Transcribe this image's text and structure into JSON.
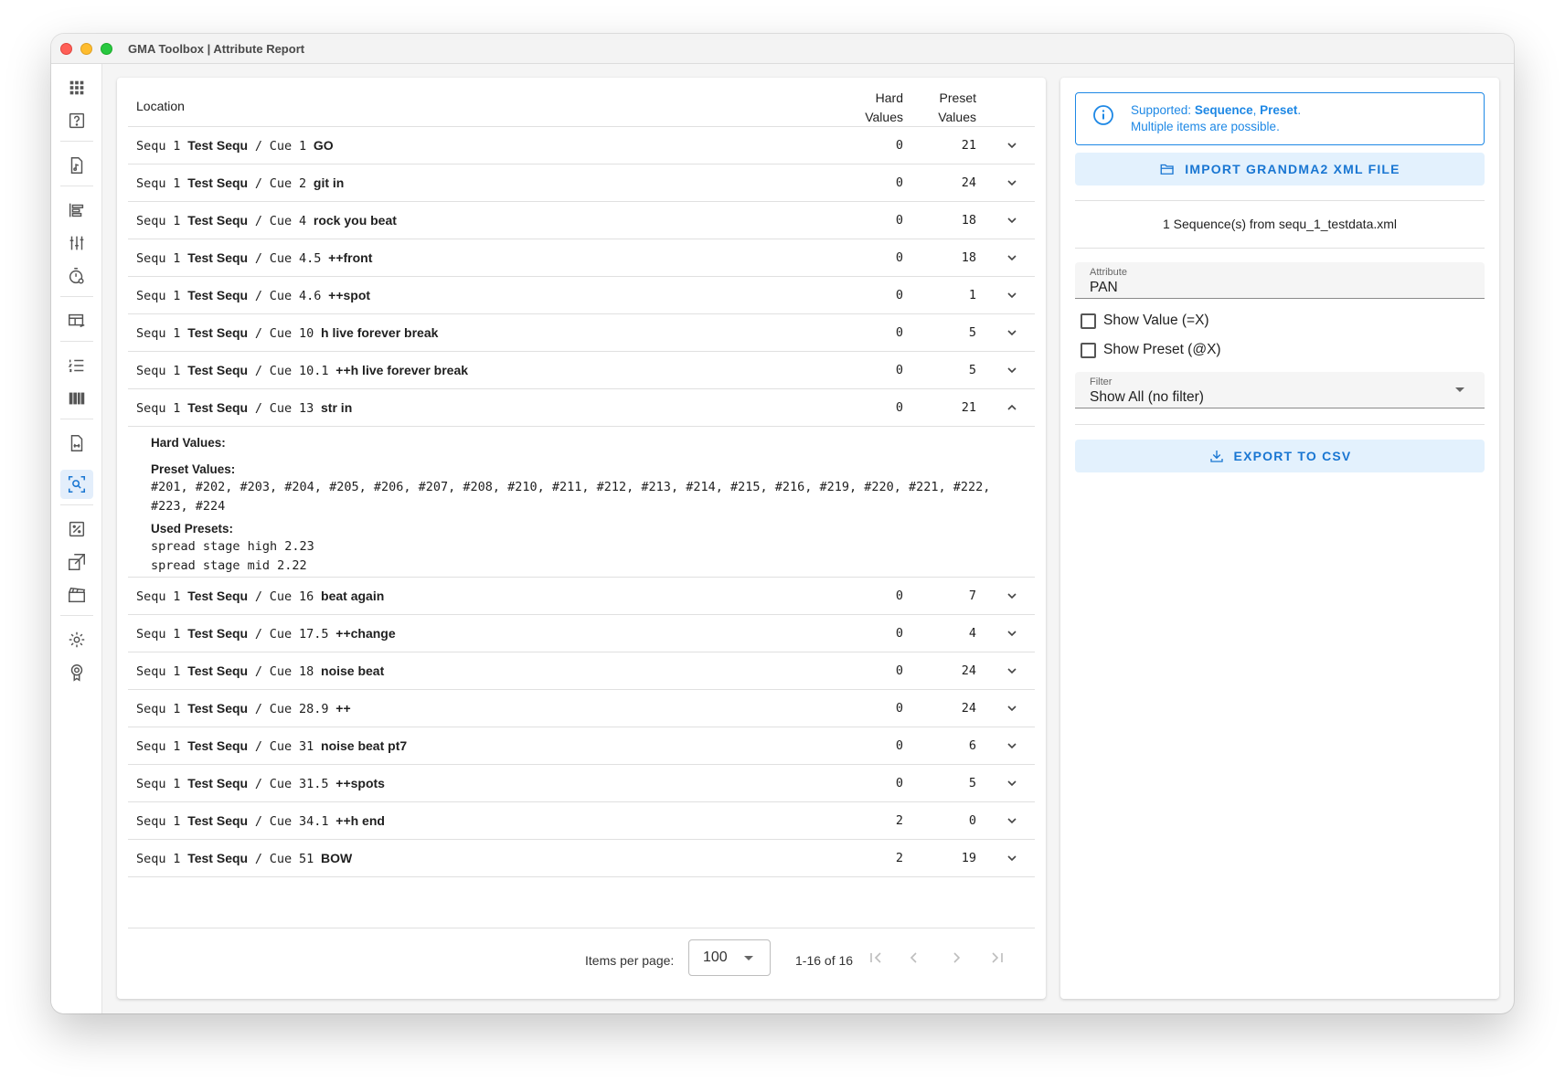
{
  "window": {
    "title": "GMA Toolbox | Attribute Report"
  },
  "table": {
    "headers": {
      "location": "Location",
      "hard_1": "Hard",
      "hard_2": "Values",
      "preset_1": "Preset",
      "preset_2": "Values"
    },
    "rows": [
      {
        "seq": "Sequ",
        "seq_no": "1",
        "seq_name": "Test Sequ",
        "sep": "/",
        "cue": "Cue",
        "cue_no": "1",
        "cue_name": "GO",
        "hard": "0",
        "preset": "21",
        "expanded": false
      },
      {
        "seq": "Sequ",
        "seq_no": "1",
        "seq_name": "Test Sequ",
        "sep": "/",
        "cue": "Cue",
        "cue_no": "2",
        "cue_name": "git in",
        "hard": "0",
        "preset": "24",
        "expanded": false
      },
      {
        "seq": "Sequ",
        "seq_no": "1",
        "seq_name": "Test Sequ",
        "sep": "/",
        "cue": "Cue",
        "cue_no": "4",
        "cue_name": "rock you beat",
        "hard": "0",
        "preset": "18",
        "expanded": false
      },
      {
        "seq": "Sequ",
        "seq_no": "1",
        "seq_name": "Test Sequ",
        "sep": "/",
        "cue": "Cue",
        "cue_no": "4.5",
        "cue_name": "++front",
        "hard": "0",
        "preset": "18",
        "expanded": false
      },
      {
        "seq": "Sequ",
        "seq_no": "1",
        "seq_name": "Test Sequ",
        "sep": "/",
        "cue": "Cue",
        "cue_no": "4.6",
        "cue_name": "++spot",
        "hard": "0",
        "preset": "1",
        "expanded": false
      },
      {
        "seq": "Sequ",
        "seq_no": "1",
        "seq_name": "Test Sequ",
        "sep": "/",
        "cue": "Cue",
        "cue_no": "10",
        "cue_name": "h live forever break",
        "hard": "0",
        "preset": "5",
        "expanded": false
      },
      {
        "seq": "Sequ",
        "seq_no": "1",
        "seq_name": "Test Sequ",
        "sep": "/",
        "cue": "Cue",
        "cue_no": "10.1",
        "cue_name": "++h live forever break",
        "hard": "0",
        "preset": "5",
        "expanded": false
      },
      {
        "seq": "Sequ",
        "seq_no": "1",
        "seq_name": "Test Sequ",
        "sep": "/",
        "cue": "Cue",
        "cue_no": "13",
        "cue_name": "str in",
        "hard": "0",
        "preset": "21",
        "expanded": true
      },
      {
        "seq": "Sequ",
        "seq_no": "1",
        "seq_name": "Test Sequ",
        "sep": "/",
        "cue": "Cue",
        "cue_no": "16",
        "cue_name": "beat again",
        "hard": "0",
        "preset": "7",
        "expanded": false
      },
      {
        "seq": "Sequ",
        "seq_no": "1",
        "seq_name": "Test Sequ",
        "sep": "/",
        "cue": "Cue",
        "cue_no": "17.5",
        "cue_name": "++change",
        "hard": "0",
        "preset": "4",
        "expanded": false
      },
      {
        "seq": "Sequ",
        "seq_no": "1",
        "seq_name": "Test Sequ",
        "sep": "/",
        "cue": "Cue",
        "cue_no": "18",
        "cue_name": "noise beat",
        "hard": "0",
        "preset": "24",
        "expanded": false
      },
      {
        "seq": "Sequ",
        "seq_no": "1",
        "seq_name": "Test Sequ",
        "sep": "/",
        "cue": "Cue",
        "cue_no": "28.9",
        "cue_name": "++",
        "hard": "0",
        "preset": "24",
        "expanded": false
      },
      {
        "seq": "Sequ",
        "seq_no": "1",
        "seq_name": "Test Sequ",
        "sep": "/",
        "cue": "Cue",
        "cue_no": "31",
        "cue_name": "noise beat pt7",
        "hard": "0",
        "preset": "6",
        "expanded": false
      },
      {
        "seq": "Sequ",
        "seq_no": "1",
        "seq_name": "Test Sequ",
        "sep": "/",
        "cue": "Cue",
        "cue_no": "31.5",
        "cue_name": "++spots",
        "hard": "0",
        "preset": "5",
        "expanded": false
      },
      {
        "seq": "Sequ",
        "seq_no": "1",
        "seq_name": "Test Sequ",
        "sep": "/",
        "cue": "Cue",
        "cue_no": "34.1",
        "cue_name": "++h end",
        "hard": "2",
        "preset": "0",
        "expanded": false
      },
      {
        "seq": "Sequ",
        "seq_no": "1",
        "seq_name": "Test Sequ",
        "sep": "/",
        "cue": "Cue",
        "cue_no": "51",
        "cue_name": "BOW",
        "hard": "2",
        "preset": "19",
        "expanded": false
      }
    ],
    "detail": {
      "hard_label": "Hard Values:",
      "preset_label": "Preset Values:",
      "preset_line_1": "#201, #202, #203, #204, #205, #206, #207, #208, #210, #211, #212, #213, #214, #215, #216, #219, #220, #221, #222,",
      "preset_line_2": "#223, #224",
      "used_label": "Used Presets:",
      "used_line_1": "spread stage high 2.23",
      "used_line_2": "spread stage mid 2.22"
    }
  },
  "paginator": {
    "items_per_page_label": "Items per page:",
    "items_per_page_value": "100",
    "range_label": "1-16 of 16"
  },
  "right": {
    "info_prefix": "Supported: ",
    "info_seq": "Sequence",
    "info_comma": ", ",
    "info_preset": "Preset",
    "info_dot": ".",
    "info_line_2": "Multiple items are possible.",
    "import_label": "IMPORT GRANDMA2 XML FILE",
    "seq_info": "1 Sequence(s) from sequ_1_testdata.xml",
    "attribute_label": "Attribute",
    "attribute_value": "PAN",
    "show_value_label": "Show Value (=X)",
    "show_preset_label": "Show Preset (@X)",
    "filter_label": "Filter",
    "filter_value": "Show All (no filter)",
    "export_label": "EXPORT TO CSV",
    "accent_color": "#1e88e5"
  }
}
